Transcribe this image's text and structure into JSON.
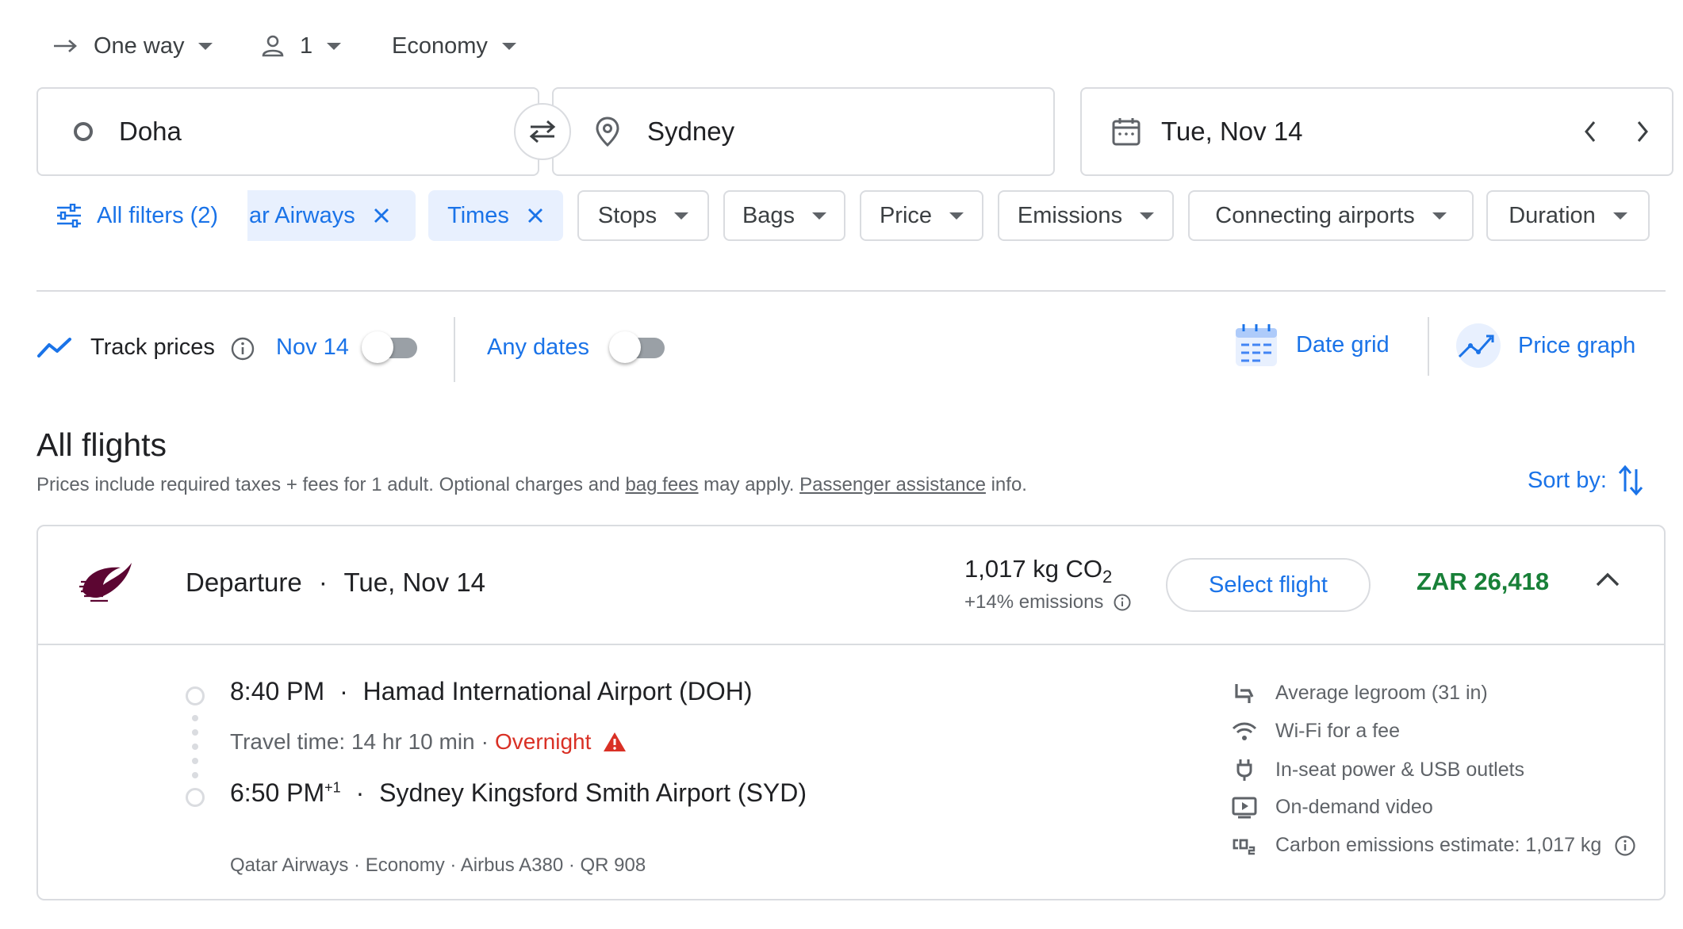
{
  "trip": {
    "type": "One way",
    "passengers": "1",
    "cabin": "Economy"
  },
  "search": {
    "origin": "Doha",
    "destination": "Sydney",
    "date": "Tue, Nov 14"
  },
  "filters": {
    "all_filters": "All filters (2)",
    "airline_chip": "ar Airways",
    "times_chip": "Times",
    "stops": "Stops",
    "bags": "Bags",
    "price": "Price",
    "emissions": "Emissions",
    "connecting": "Connecting airports",
    "duration": "Duration"
  },
  "tracking": {
    "track_prices": "Track prices",
    "track_date": "Nov 14",
    "any_dates": "Any dates",
    "date_grid": "Date grid",
    "price_graph": "Price graph"
  },
  "results": {
    "heading": "All flights",
    "note_prefix": "Prices include required taxes + fees for 1 adult. Optional charges and ",
    "note_bag_fees": "bag fees",
    "note_middle": " may apply. ",
    "note_assistance": "Passenger assistance",
    "note_suffix": " info.",
    "sort_by": "Sort by:"
  },
  "flight": {
    "label": "Departure",
    "separator": "·",
    "date": "Tue, Nov 14",
    "emissions_value": "1,017 kg CO",
    "emissions_sub": "2",
    "emissions_delta": "+14% emissions",
    "select_label": "Select flight",
    "price": "ZAR 26,418",
    "depart_time": "8:40 PM",
    "depart_airport": "Hamad International Airport (DOH)",
    "travel_time": "Travel time: 14 hr 10 min",
    "overnight": "Overnight",
    "arrive_time": "6:50 PM",
    "arrive_plus": "+1",
    "arrive_airport": "Sydney Kingsford Smith Airport (SYD)",
    "details": "Qatar Airways · Economy · Airbus A380 · QR 908",
    "amenities": [
      "Average legroom (31 in)",
      "Wi-Fi for a fee",
      "In-seat power & USB outlets",
      "On-demand video",
      "Carbon emissions estimate: 1,017 kg"
    ]
  },
  "colors": {
    "accent": "#1a73e8",
    "price_green": "#188038",
    "warning_red": "#d93025",
    "border": "#dadce0"
  }
}
